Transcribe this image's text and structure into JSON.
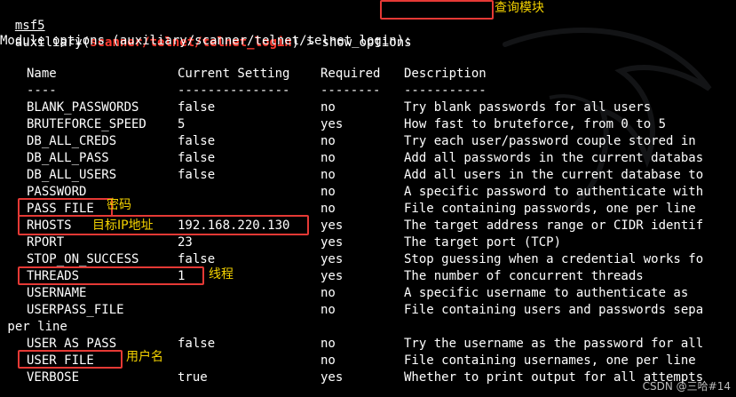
{
  "prompt": {
    "prefix": "msf5",
    "module_word": "auxiliary(",
    "module_path": "scanner/telnet/telnet_login",
    "close_paren": ") > ",
    "command": "show options"
  },
  "heading": "Module options (auxiliary/scanner/telnet/telnet_login):",
  "table": {
    "headers": [
      "Name",
      "Current Setting",
      "Required",
      "Description"
    ],
    "separators": [
      "----",
      "---------------",
      "--------",
      "-----------"
    ],
    "rows": [
      {
        "name": "BLANK_PASSWORDS",
        "current": "false",
        "required": "no",
        "desc": "Try blank passwords for all users"
      },
      {
        "name": "BRUTEFORCE_SPEED",
        "current": "5",
        "required": "yes",
        "desc": "How fast to bruteforce, from 0 to 5"
      },
      {
        "name": "DB_ALL_CREDS",
        "current": "false",
        "required": "no",
        "desc": "Try each user/password couple stored in"
      },
      {
        "name": "DB_ALL_PASS",
        "current": "false",
        "required": "no",
        "desc": "Add all passwords in the current databas"
      },
      {
        "name": "DB_ALL_USERS",
        "current": "false",
        "required": "no",
        "desc": "Add all users in the current database to"
      },
      {
        "name": "PASSWORD",
        "current": "",
        "required": "no",
        "desc": "A specific password to authenticate with"
      },
      {
        "name": "PASS_FILE",
        "current": "",
        "required": "no",
        "desc": "File containing passwords, one per line"
      },
      {
        "name": "RHOSTS",
        "current": "192.168.220.130",
        "required": "yes",
        "desc": "The target address range or CIDR identif"
      },
      {
        "name": "RPORT",
        "current": "23",
        "required": "yes",
        "desc": "The target port (TCP)"
      },
      {
        "name": "STOP_ON_SUCCESS",
        "current": "false",
        "required": "yes",
        "desc": "Stop guessing when a credential works fo"
      },
      {
        "name": "THREADS",
        "current": "1",
        "required": "yes",
        "desc": "The number of concurrent threads"
      },
      {
        "name": "USERNAME",
        "current": "",
        "required": "no",
        "desc": "A specific username to authenticate as"
      },
      {
        "name": "USERPASS_FILE",
        "current": "",
        "required": "no",
        "desc": "File containing users and passwords sepa"
      },
      {
        "wrap": " per line"
      },
      {
        "name": "USER_AS_PASS",
        "current": "false",
        "required": "no",
        "desc": "Try the username as the password for all"
      },
      {
        "name": "USER_FILE",
        "current": "",
        "required": "no",
        "desc": "File containing usernames, one per line"
      },
      {
        "name": "VERBOSE",
        "current": "true",
        "required": "yes",
        "desc": "Whether to print output for all attempts"
      }
    ]
  },
  "annotations": {
    "command": "查询模块",
    "pass_file": "密码",
    "rhosts": "目标IP地址",
    "threads": "线程",
    "user_file": "用户名"
  },
  "watermark": "CSDN @三哈#14",
  "colors": {
    "background": "#000000",
    "text": "#ffffff",
    "module_path": "#ff3b30",
    "box": "#e53935",
    "annotation": "#f5d300"
  }
}
